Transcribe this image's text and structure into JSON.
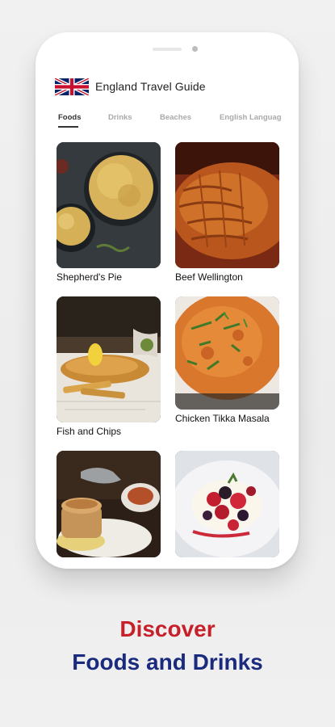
{
  "app": {
    "title": "England Travel Guide",
    "flag_icon": "uk-flag-icon"
  },
  "tabs": [
    {
      "label": "Foods",
      "active": true
    },
    {
      "label": "Drinks",
      "active": false
    },
    {
      "label": "Beaches",
      "active": false
    },
    {
      "label": "English Languag",
      "active": false
    }
  ],
  "items": [
    {
      "name": "Shepherd's Pie"
    },
    {
      "name": "Beef Wellington"
    },
    {
      "name": "Fish and Chips"
    },
    {
      "name": "Chicken Tikka Masala"
    },
    {
      "name": ""
    },
    {
      "name": ""
    }
  ],
  "tagline": {
    "line1": "Discover",
    "line2": "Foods and Drinks"
  },
  "colors": {
    "accent_red": "#c6202a",
    "accent_blue": "#1a2a7d"
  }
}
